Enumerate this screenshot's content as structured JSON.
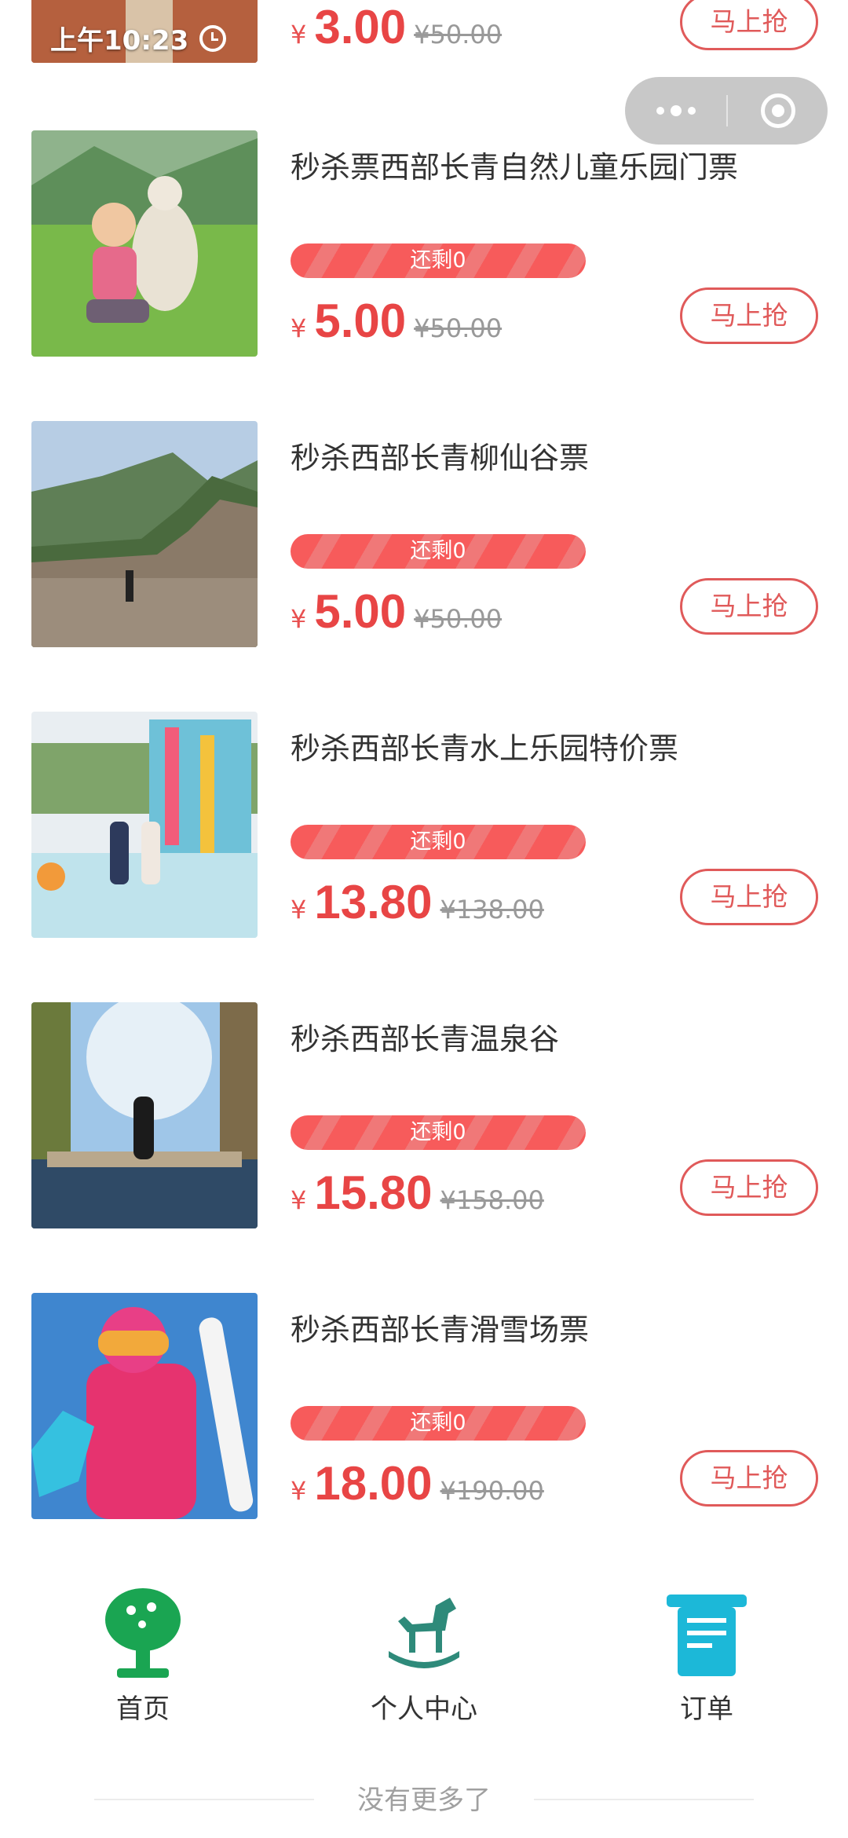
{
  "status": {
    "time": "上午10:23"
  },
  "items": [
    {
      "title": "",
      "stock": "",
      "currency": "¥",
      "price": "3.00",
      "original": "¥50.00",
      "button": "马上抢"
    },
    {
      "title": "秒杀票西部长青自然儿童乐园门票",
      "stock": "还剩0",
      "currency": "¥",
      "price": "5.00",
      "original": "¥50.00",
      "button": "马上抢"
    },
    {
      "title": "秒杀西部长青柳仙谷票",
      "stock": "还剩0",
      "currency": "¥",
      "price": "5.00",
      "original": "¥50.00",
      "button": "马上抢"
    },
    {
      "title": "秒杀西部长青水上乐园特价票",
      "stock": "还剩0",
      "currency": "¥",
      "price": "13.80",
      "original": "¥138.00",
      "button": "马上抢"
    },
    {
      "title": "秒杀西部长青温泉谷",
      "stock": "还剩0",
      "currency": "¥",
      "price": "15.80",
      "original": "¥158.00",
      "button": "马上抢"
    },
    {
      "title": "秒杀西部长青滑雪场票",
      "stock": "还剩0",
      "currency": "¥",
      "price": "18.00",
      "original": "¥190.00",
      "button": "马上抢"
    }
  ],
  "tabs": [
    {
      "label": "首页",
      "icon": "tree-icon",
      "color": "#1aa552"
    },
    {
      "label": "个人中心",
      "icon": "rocking-horse-icon",
      "color": "#2e8a7a"
    },
    {
      "label": "订单",
      "icon": "order-icon",
      "color": "#1cb8d8"
    }
  ],
  "footer": {
    "text": "没有更多了"
  },
  "colors": {
    "accent": "#e84545",
    "stock_bar": "#f75b5b"
  }
}
